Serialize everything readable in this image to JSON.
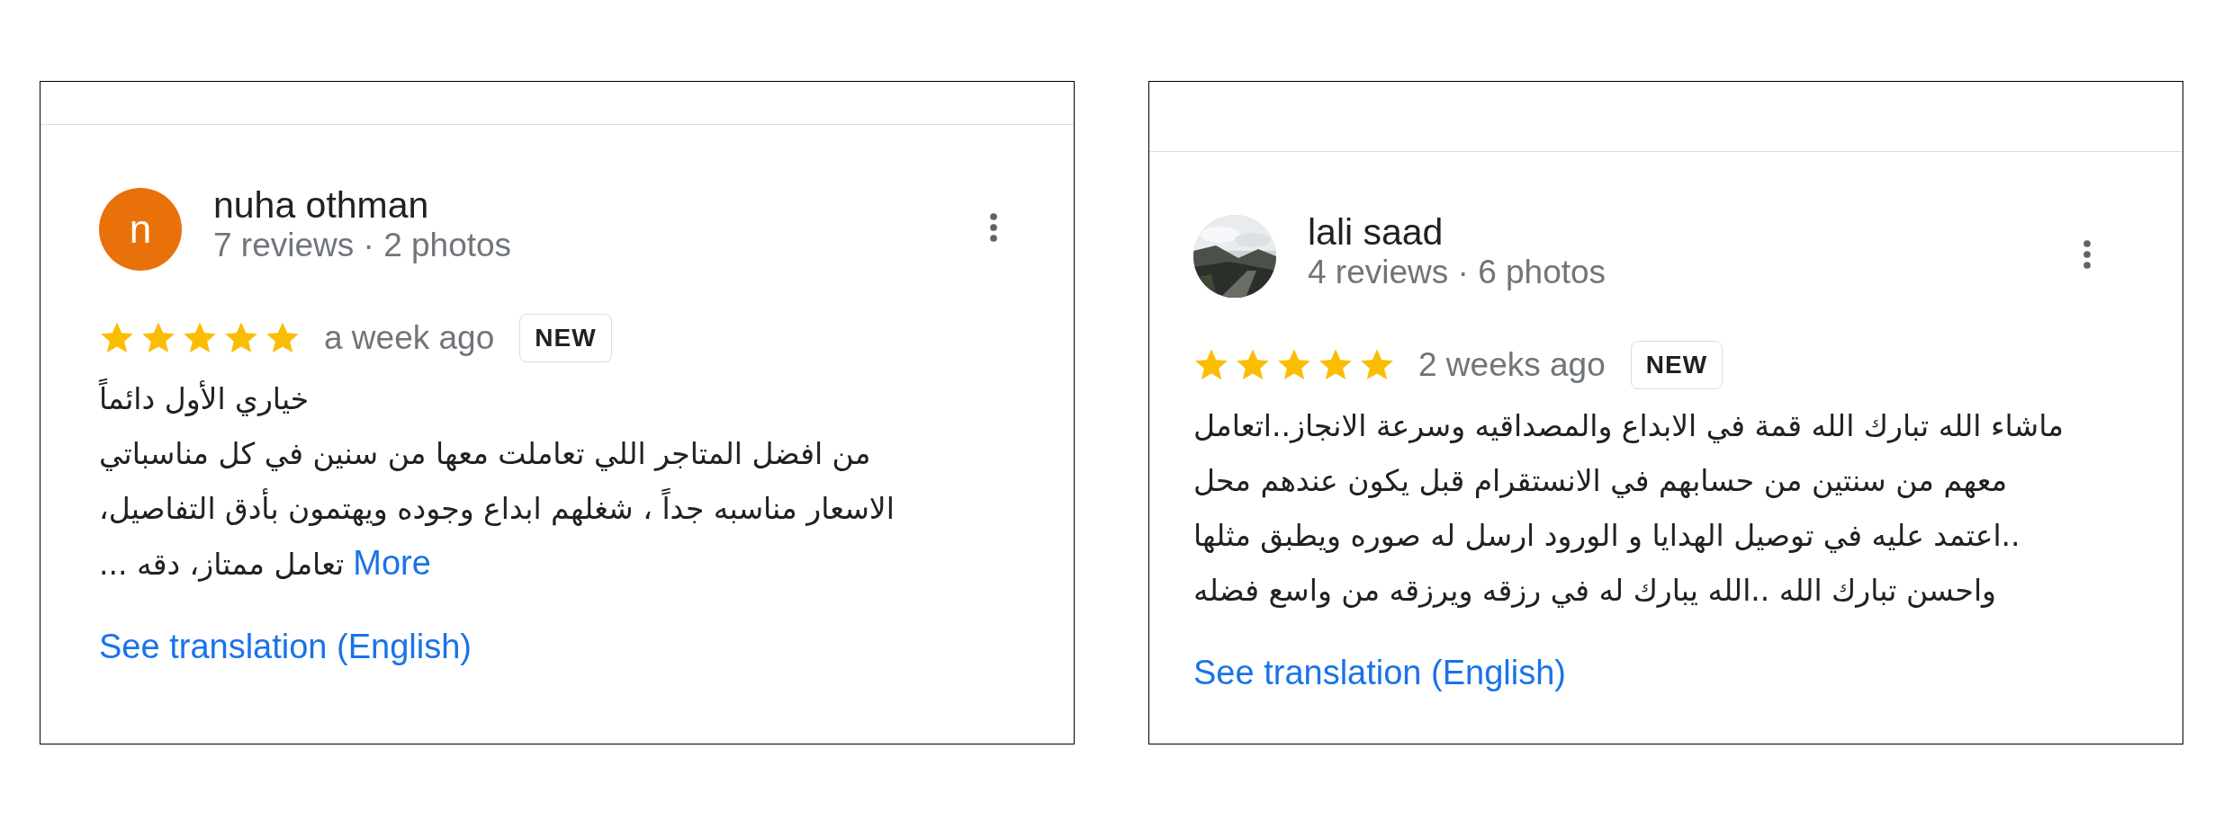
{
  "reviews": [
    {
      "name": "nuha othman",
      "avatar": {
        "kind": "letter",
        "letter": "n",
        "color": "#e8710a"
      },
      "meta": "7 reviews · 2 photos",
      "stars": 5,
      "time": "a week ago",
      "badge": "NEW",
      "lines": [
        "خياري الأول دائماً",
        "من افضل المتاجر اللي تعاملت معها  من سنين  في كل مناسباتي",
        "الاسعار مناسبه جداً ، شغلهم ابداع وجوده ويهتمون بأدق التفاصيل،",
        "تعامل ممتاز، دقه ..."
      ],
      "more": "More",
      "translation": "See translation (English)"
    },
    {
      "name": "lali saad",
      "meta": "4 reviews · 6 photos",
      "stars": 5,
      "time": "2 weeks ago",
      "badge": "NEW",
      "lines": [
        "ماشاء الله تبارك الله قمة في الابداع والمصداقيه وسرعة الانجاز..اتعامل",
        "معهم من سنتين من حسابهم في الانستقرام قبل يكون عندهم محل",
        "..اعتمد عليه في توصيل الهدايا و الورود ارسل له صوره ويطبق مثلها",
        "واحسن تبارك الله ..الله يبارك له في رزقه ويرزقه من واسع فضله"
      ],
      "translation": "See translation (English)"
    }
  ]
}
